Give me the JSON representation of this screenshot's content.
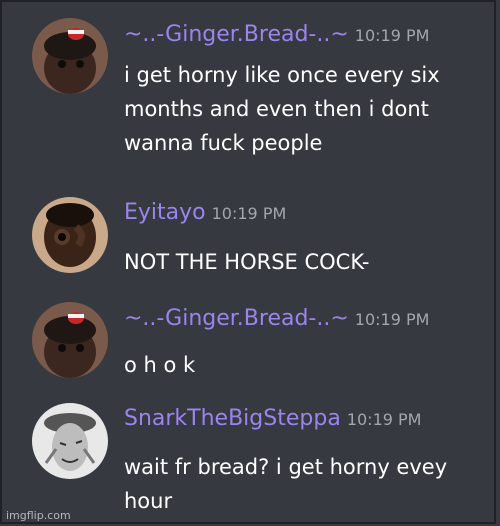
{
  "messages": [
    {
      "author": "~..-Ginger.Bread-..~",
      "time": "10:19 PM",
      "avatar_icon": "gingerbread-avatar",
      "lines": [
        "i get horny like once every six",
        "months and even then i dont",
        "wanna fuck people"
      ]
    },
    {
      "author": "Eyitayo",
      "time": "10:19 PM",
      "avatar_icon": "eyitayo-avatar",
      "lines": [
        "NOT THE HORSE COCK-"
      ]
    },
    {
      "author": "~..-Ginger.Bread-..~",
      "time": "10:19 PM",
      "avatar_icon": "gingerbread-avatar",
      "lines": [
        "o h o k"
      ]
    },
    {
      "author": "SnarkTheBigSteppa",
      "time": "10:19 PM",
      "avatar_icon": "snark-avatar",
      "lines": [
        "wait fr bread? i get horny evey",
        "hour"
      ]
    }
  ],
  "watermark": "imgflip.com",
  "colors": {
    "background": "#36393f",
    "username": "#9b84ee",
    "timestamp": "#a3a6aa",
    "text": "#ffffff"
  }
}
